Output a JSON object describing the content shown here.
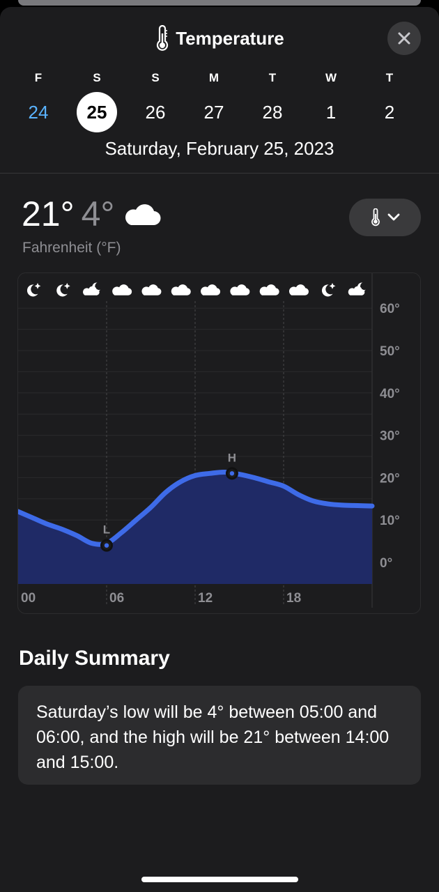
{
  "header": {
    "title": "Temperature",
    "title_icon": "thermometer-icon",
    "close_icon": "xmark-icon"
  },
  "days": [
    {
      "dow": "F",
      "num": "24",
      "state": "today"
    },
    {
      "dow": "S",
      "num": "25",
      "state": "selected"
    },
    {
      "dow": "S",
      "num": "26",
      "state": ""
    },
    {
      "dow": "M",
      "num": "27",
      "state": ""
    },
    {
      "dow": "T",
      "num": "28",
      "state": ""
    },
    {
      "dow": "W",
      "num": "1",
      "state": ""
    },
    {
      "dow": "T",
      "num": "2",
      "state": ""
    }
  ],
  "selected_date": "Saturday, February 25, 2023",
  "current": {
    "high": "21°",
    "low": "4°",
    "condition_icon": "cloud-icon",
    "unit": "Fahrenheit (°F)",
    "metric_button_icons": [
      "thermometer-icon",
      "chevron-down-icon"
    ]
  },
  "chart_data": {
    "type": "area",
    "x_tick_labels": [
      "00",
      "06",
      "12",
      "18"
    ],
    "y_tick_labels": [
      "60°",
      "50°",
      "40°",
      "30°",
      "20°",
      "10°",
      "0°"
    ],
    "ylim": [
      -5,
      65
    ],
    "xlim": [
      0,
      24
    ],
    "hours": [
      0,
      1,
      2,
      3,
      4,
      5,
      6,
      7,
      8,
      9,
      10,
      11,
      12,
      13,
      14,
      15,
      16,
      17,
      18,
      19,
      20,
      21,
      22,
      23,
      24
    ],
    "values": [
      12,
      10.5,
      9,
      7.8,
      6.3,
      4.5,
      4.5,
      7,
      10,
      13,
      16.5,
      19,
      20.5,
      21,
      21.3,
      20.8,
      20,
      19,
      18,
      16,
      14.5,
      13.8,
      13.5,
      13.4,
      13.3
    ],
    "low": {
      "label": "L",
      "hour": 6,
      "value": 4
    },
    "high": {
      "label": "H",
      "hour": 14.5,
      "value": 21
    },
    "condition_icons": [
      "moon-icon",
      "moon-icon",
      "cloud-moon-icon",
      "cloud-icon",
      "cloud-icon",
      "cloud-icon",
      "cloud-icon",
      "cloud-icon",
      "cloud-icon",
      "cloud-icon",
      "moon-icon",
      "cloud-moon-icon"
    ],
    "colors": {
      "line": "#3e6be8",
      "fill": "#1f2a66",
      "axis_text": "#8e8e93",
      "grid": "#2c2c2e"
    }
  },
  "summary": {
    "title": "Daily Summary",
    "text": "Saturday’s low will be 4° between 05:00 and 06:00, and the high will be 21° between 14:00 and 15:00."
  }
}
